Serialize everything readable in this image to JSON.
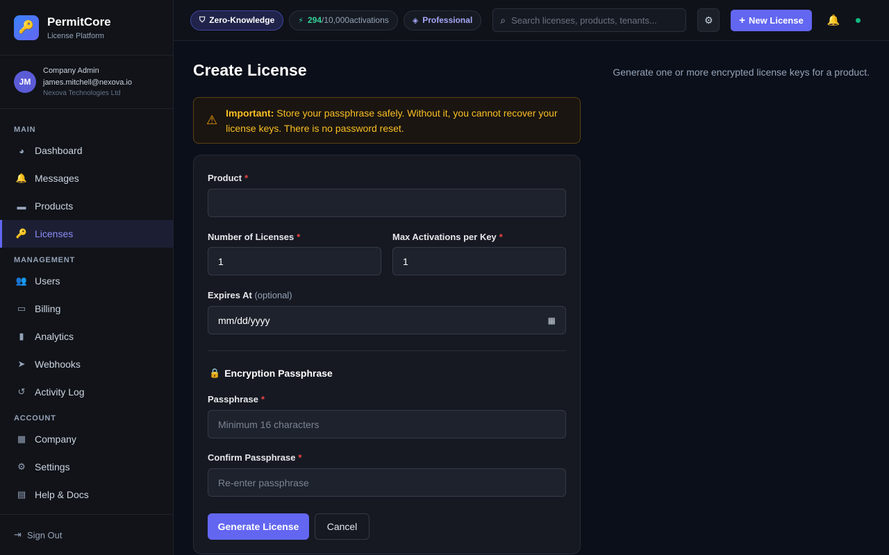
{
  "brand": {
    "name": "PermitCore",
    "subtitle": "License Platform",
    "logo_icon": "key-icon"
  },
  "user": {
    "initials": "JM",
    "role": "Company Admin",
    "email": "james.mitchell@nexova.io",
    "company": "Nexova Technologies Ltd"
  },
  "sidebar": {
    "sections": [
      {
        "title": "MAIN",
        "items": [
          {
            "label": "Dashboard",
            "icon": "gauge-icon",
            "glyph": "◕"
          },
          {
            "label": "Messages",
            "icon": "bell-icon",
            "glyph": "🔔"
          },
          {
            "label": "Products",
            "icon": "box-icon",
            "glyph": "▬"
          },
          {
            "label": "Licenses",
            "icon": "key-icon",
            "glyph": "🔑",
            "active": true
          }
        ]
      },
      {
        "title": "MANAGEMENT",
        "items": [
          {
            "label": "Users",
            "icon": "users-icon",
            "glyph": "👥"
          },
          {
            "label": "Billing",
            "icon": "credit-card-icon",
            "glyph": "▭"
          },
          {
            "label": "Analytics",
            "icon": "chart-icon",
            "glyph": "▮"
          },
          {
            "label": "Webhooks",
            "icon": "paper-plane-icon",
            "glyph": "➤"
          },
          {
            "label": "Activity Log",
            "icon": "history-icon",
            "glyph": "↺"
          }
        ]
      },
      {
        "title": "ACCOUNT",
        "items": [
          {
            "label": "Company",
            "icon": "building-icon",
            "glyph": "▦"
          },
          {
            "label": "Settings",
            "icon": "gear-icon",
            "glyph": "⚙"
          },
          {
            "label": "Help & Docs",
            "icon": "book-icon",
            "glyph": "▤"
          }
        ]
      }
    ],
    "signout_label": "Sign Out"
  },
  "topbar": {
    "zk_label": "Zero-Knowledge",
    "activations_used": "294",
    "activations_total": "/10,000",
    "activations_suffix": " activations",
    "plan_label": "Professional",
    "search_placeholder": "Search licenses, products, tenants...",
    "new_license_label": "New License"
  },
  "page": {
    "title": "Create License",
    "description": "Generate one or more encrypted license keys for a product."
  },
  "alert": {
    "strong": "Important:",
    "text": " Store your passphrase safely. Without it, you cannot recover your license keys. There is no password reset."
  },
  "form": {
    "product_label": "Product",
    "product_value": "",
    "num_licenses_label": "Number of Licenses",
    "num_licenses_value": "1",
    "max_activations_label": "Max Activations per Key",
    "max_activations_value": "1",
    "expires_label": "Expires At",
    "expires_optional": " (optional)",
    "expires_placeholder": "mm/dd/yyyy",
    "section_title": "Encryption Passphrase",
    "passphrase_label": "Passphrase",
    "passphrase_placeholder": "Minimum 16 characters",
    "confirm_label": "Confirm Passphrase",
    "confirm_placeholder": "Re-enter passphrase",
    "required_mark": "*",
    "submit_label": "Generate License",
    "cancel_label": "Cancel"
  },
  "colors": {
    "accent": "#6366f1",
    "warning": "#f59e0b",
    "success": "#10b981",
    "required": "#ef4444"
  }
}
